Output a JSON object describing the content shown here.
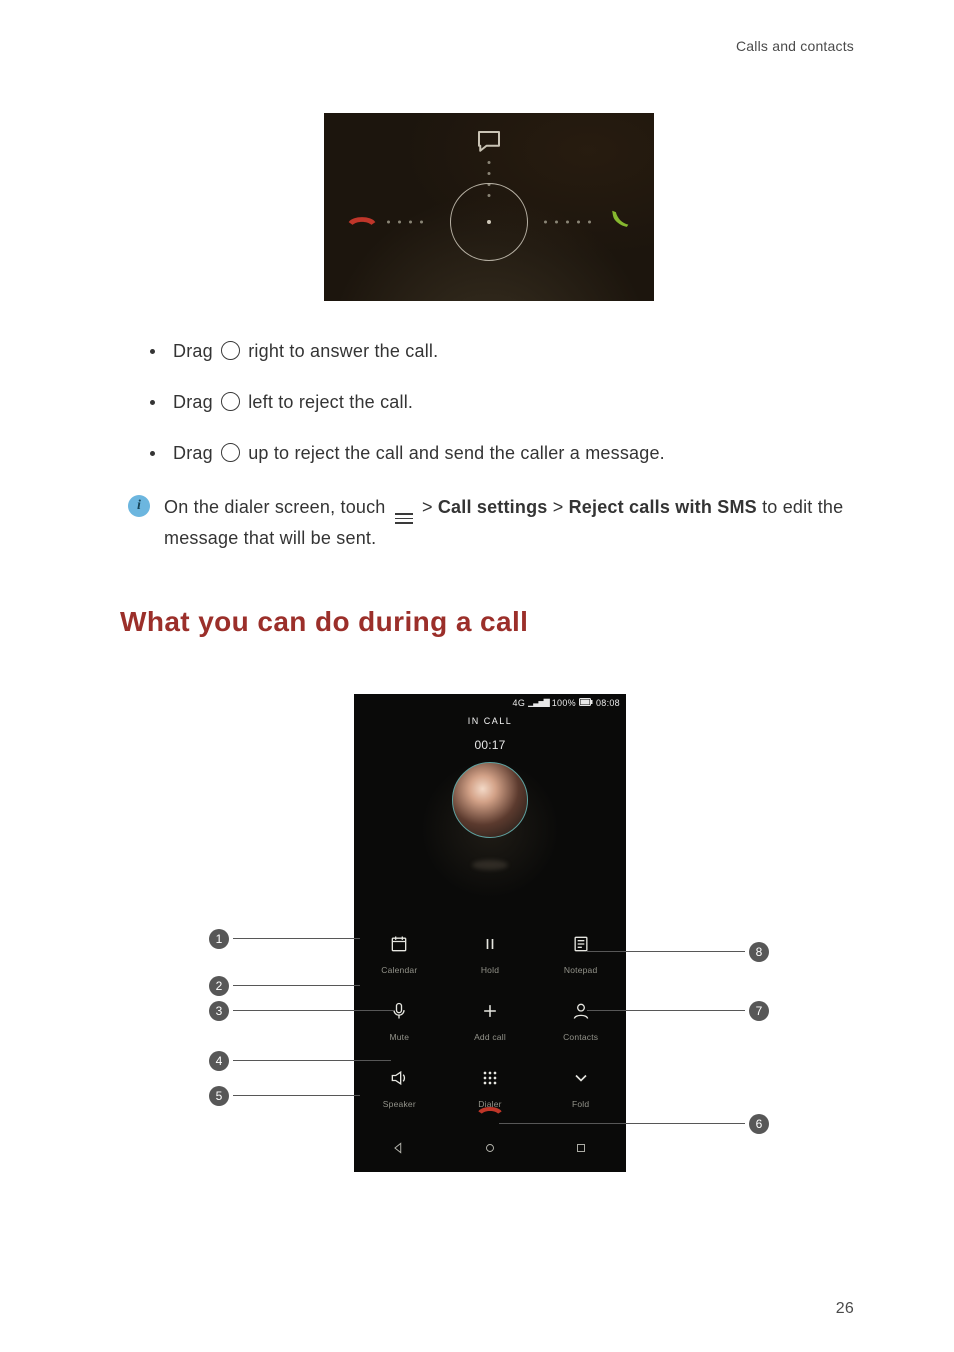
{
  "header": {
    "section": "Calls and contacts"
  },
  "bullets": {
    "prefix": "Drag ",
    "items": [
      {
        "text": "right to answer the call."
      },
      {
        "text": "left to reject the call."
      },
      {
        "text": "up to reject the call and send the caller a message."
      }
    ]
  },
  "info_note": {
    "pre": "On the dialer screen, touch ",
    "gt1": " > ",
    "bold1": "Call settings",
    "gt2": " > ",
    "bold2": "Reject calls with SMS",
    "post": " to edit the message that will be sent."
  },
  "section_heading": "What you can do during a call",
  "incall": {
    "status": {
      "carrier_icons": "4G",
      "signal": "▮▮▮",
      "battery": "100%",
      "battery_icon": "▮",
      "time": "08:08"
    },
    "label": "IN CALL",
    "timer": "00:17",
    "grid": {
      "r1c1": "Calendar",
      "r1c2": "Hold",
      "r1c3": "Notepad",
      "r2c1": "Mute",
      "r2c2": "Add call",
      "r2c3": "Contacts",
      "r3c1": "Speaker",
      "r3c2": "Dialer",
      "r3c3": "Fold"
    },
    "icons": {
      "calendar": "calendar-icon",
      "hold": "pause-icon",
      "notepad": "notepad-icon",
      "mute": "mic-off-icon",
      "addcall": "plus-icon",
      "contacts": "contact-icon",
      "speaker": "speaker-icon",
      "dialer": "keypad-icon",
      "fold": "chevron-down-icon",
      "endcall": "hangup-icon"
    }
  },
  "callout_numbers": {
    "n1": "1",
    "n2": "2",
    "n3": "3",
    "n4": "4",
    "n5": "5",
    "n6": "6",
    "n7": "7",
    "n8": "8"
  },
  "page_number": "26"
}
